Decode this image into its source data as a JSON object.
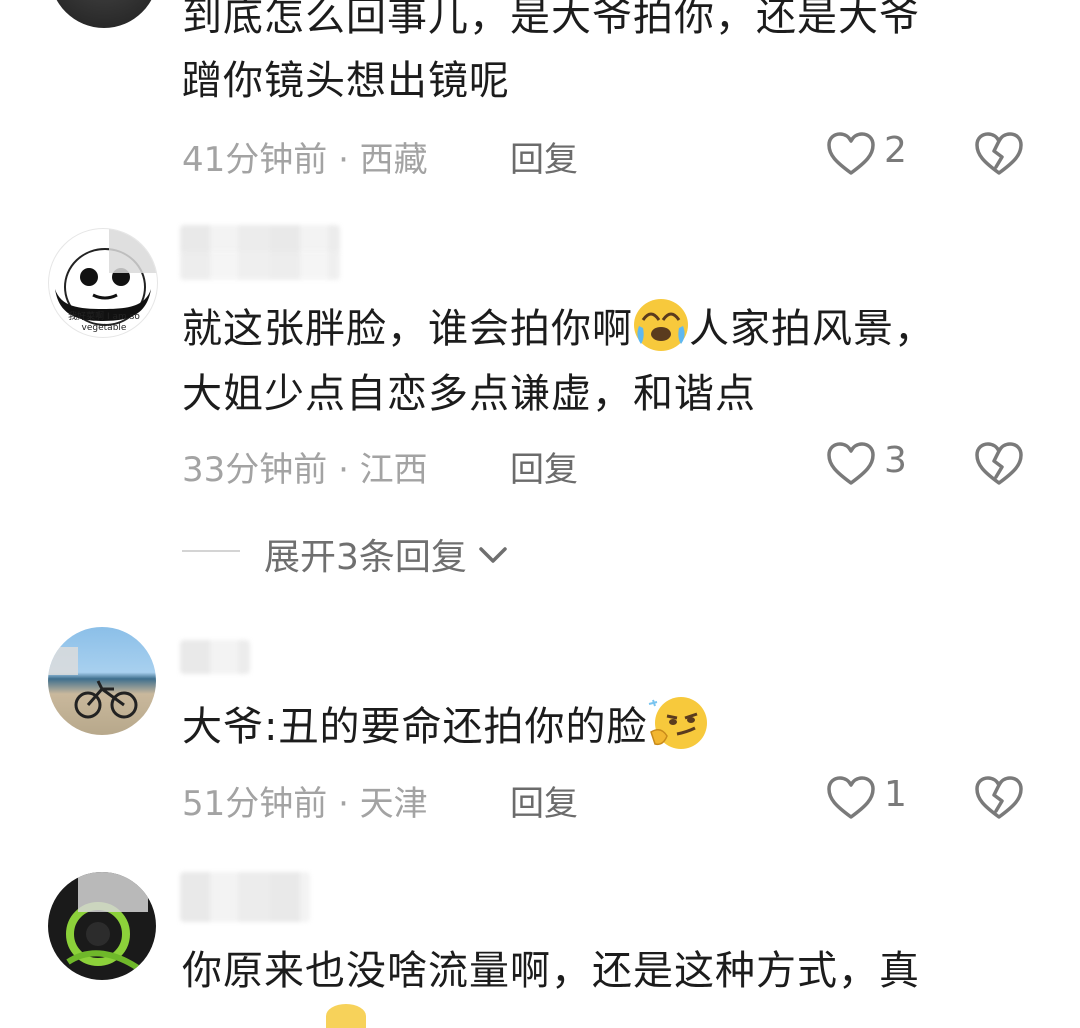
{
  "comments": [
    {
      "text_line1": "到底怎么回事儿，是大爷拍你，还是大爷",
      "text_line2": "蹭你镜头想出镜呢",
      "meta": "41分钟前 · 西藏",
      "reply_label": "回复",
      "likes": "2"
    },
    {
      "avatar_caption": "我好菜啊 I am so vegetable",
      "text_line1": "就这张胖脸，谁会拍你啊",
      "text_line1_tail": "人家拍风景，",
      "text_line2": "大姐少点自恋多点谦虚，和谐点",
      "meta": "33分钟前 · 江西",
      "reply_label": "回复",
      "likes": "3",
      "expand_label": "展开3条回复"
    },
    {
      "text_line1": "大爷:丑的要命还拍你的脸",
      "meta": "51分钟前 · 天津",
      "reply_label": "回复",
      "likes": "1"
    },
    {
      "text_line1": "你原来也没啥流量啊，还是这种方式，真"
    }
  ],
  "icons": {
    "like": "heart-outline-icon",
    "dislike": "broken-heart-icon",
    "expand": "chevron-down-icon"
  },
  "colors": {
    "text": "#1c1c1c",
    "meta": "#a3a3a3",
    "reply": "#6b6b6b",
    "icon": "#7a7a7a"
  }
}
